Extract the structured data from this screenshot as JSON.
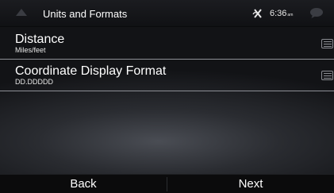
{
  "header": {
    "title": "Units and Formats",
    "back_icon": "back-arrow-icon",
    "gps_icon": "gps-satellite-icon",
    "time": "6:36",
    "time_suffix": "am",
    "message_icon": "chat-bubble-icon"
  },
  "settings": {
    "items": [
      {
        "label": "Distance",
        "value": "Miles/feet",
        "icon": "menu-list-icon"
      },
      {
        "label": "Coordinate Display Format",
        "value": "DD.DDDDD",
        "icon": "menu-list-icon"
      }
    ]
  },
  "footer": {
    "back_label": "Back",
    "next_label": "Next"
  },
  "colors": {
    "background": "#121316",
    "divider": "#8e9097",
    "text": "#ffffff"
  }
}
